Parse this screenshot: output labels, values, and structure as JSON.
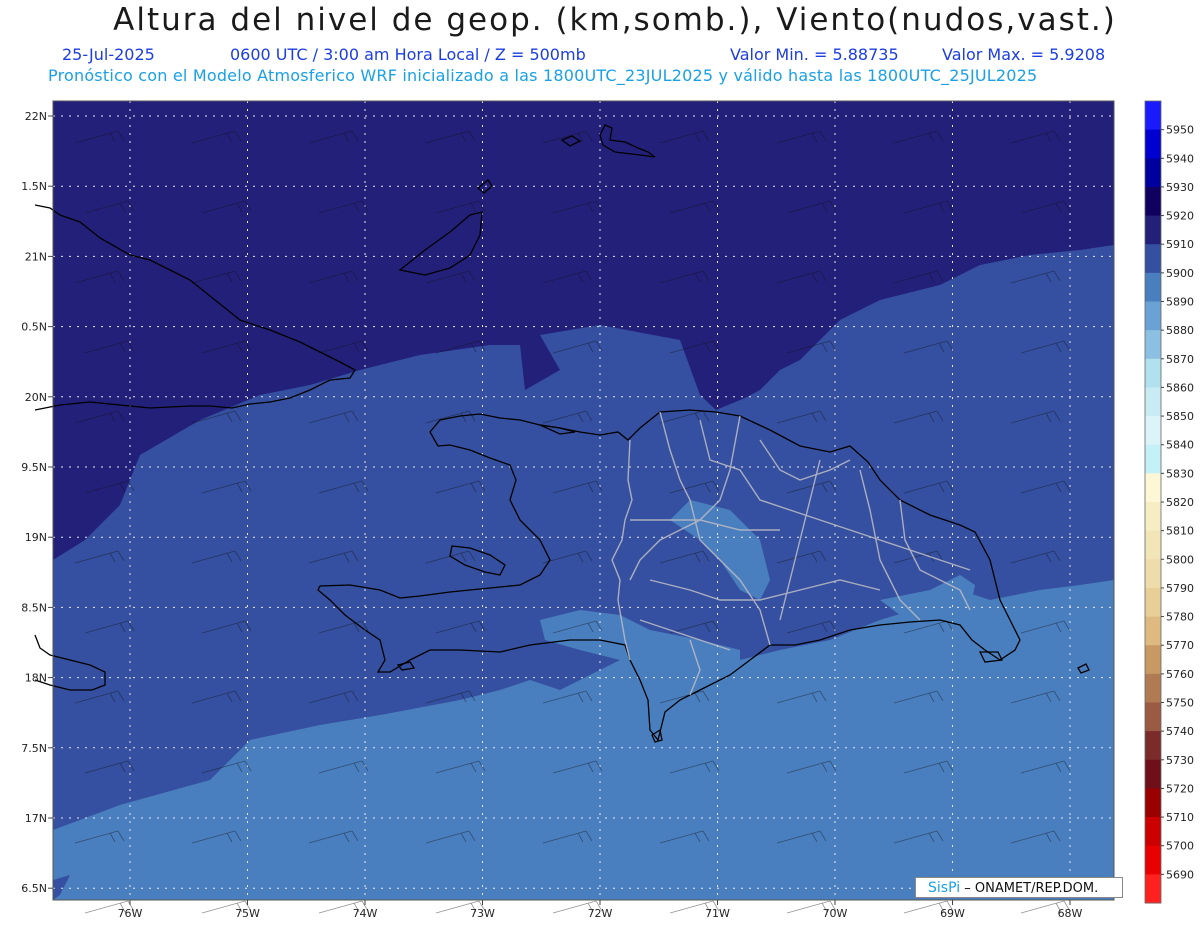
{
  "title": "Altura del nivel de geop. (km,somb.), Viento(nudos,vast.)",
  "subtitle": {
    "date": "25-Jul-2025",
    "time": "0600 UTC / 3:00 am Hora Local / Z = 500mb",
    "min": "Valor Min. = 5.88735",
    "max": "Valor Max. = 5.9208"
  },
  "info_line": "Pronóstico con el Modelo Atmosferico WRF inicializado a las 1800UTC_23JUL2025 y válido hasta las  1800UTC_25JUL2025",
  "lat_labels": [
    "22N",
    "1.5N",
    "21N",
    "0.5N",
    "20N",
    "9.5N",
    "19N",
    "8.5N",
    "18N",
    "7.5N",
    "17N",
    "6.5N"
  ],
  "lon_labels": [
    "76W",
    "75W",
    "74W",
    "73W",
    "72W",
    "71W",
    "70W",
    "69W",
    "68W"
  ],
  "colorbar": {
    "labels": [
      "5950",
      "5940",
      "5930",
      "5920",
      "5910",
      "5900",
      "5890",
      "5880",
      "5870",
      "5860",
      "5850",
      "5840",
      "5830",
      "5820",
      "5810",
      "5800",
      "5790",
      "5780",
      "5770",
      "5760",
      "5750",
      "5740",
      "5730",
      "5720",
      "5710",
      "5700",
      "5690"
    ],
    "colors": [
      "#1a1aff",
      "#0000d0",
      "#0000a0",
      "#100060",
      "#23207a",
      "#3550a0",
      "#4a7fbf",
      "#6aa2d6",
      "#8cc0e2",
      "#b1e0ef",
      "#c8ebf4",
      "#dcf3f8",
      "#c4f0f7",
      "#fdf7d6",
      "#f6edc4",
      "#f2e5b8",
      "#eedcaa",
      "#e8cf98",
      "#deba80",
      "#c99964",
      "#b07a52",
      "#9b5a43",
      "#7c2b2b",
      "#6e0f1a",
      "#9b0000",
      "#cc0000",
      "#e90000",
      "#ff2020"
    ]
  },
  "colors": {
    "deep": "#23207a",
    "mid": "#3550a0",
    "light": "#4a7fbf",
    "lighter": "#6aa2d6"
  },
  "watermark": {
    "brand": "SisPi",
    "text": "– ONAMET/REP.DOM."
  }
}
